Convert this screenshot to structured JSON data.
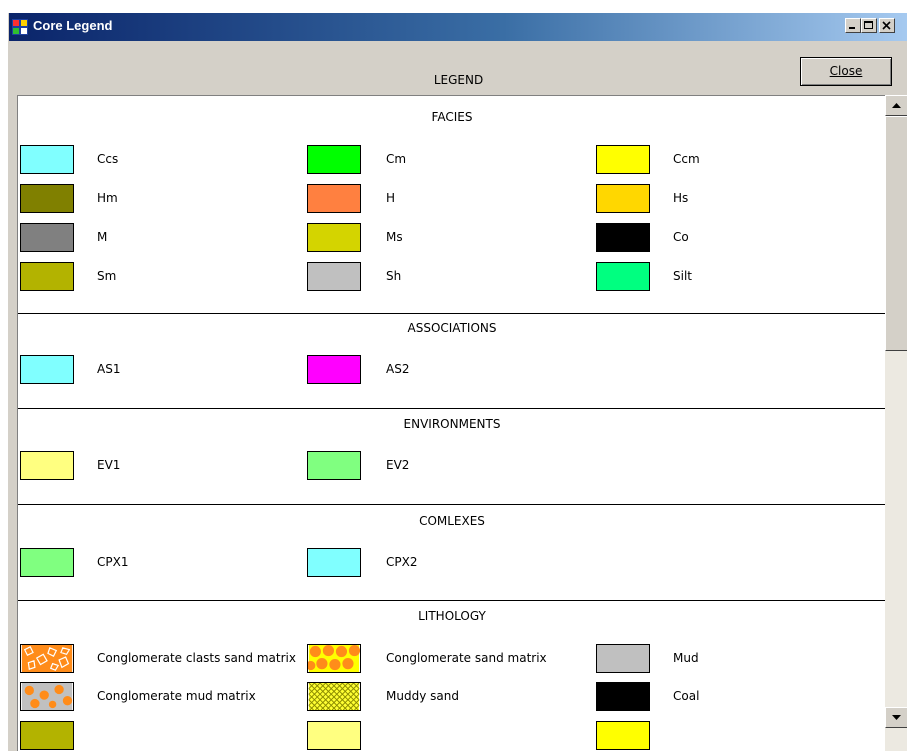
{
  "window": {
    "title": "Core Legend",
    "app_icon": "app-icon"
  },
  "header": {
    "legend_title": "LEGEND",
    "close_label": "Close"
  },
  "sections": {
    "facies": {
      "title": "FACIES",
      "items": [
        {
          "label": "Ccs",
          "color": "#80ffff"
        },
        {
          "label": "Cm",
          "color": "#00ff00"
        },
        {
          "label": "Ccm",
          "color": "#ffff00"
        },
        {
          "label": "Hm",
          "color": "#808000"
        },
        {
          "label": "H",
          "color": "#ff8040"
        },
        {
          "label": "Hs",
          "color": "#ffd700"
        },
        {
          "label": "M",
          "color": "#808080"
        },
        {
          "label": "Ms",
          "color": "#d4d400"
        },
        {
          "label": "Co",
          "color": "#000000"
        },
        {
          "label": "Sm",
          "color": "#b3b300"
        },
        {
          "label": "Sh",
          "color": "#c0c0c0"
        },
        {
          "label": "Silt",
          "color": "#00ff80"
        }
      ]
    },
    "associations": {
      "title": "ASSOCIATIONS",
      "items": [
        {
          "label": "AS1",
          "color": "#80ffff"
        },
        {
          "label": "AS2",
          "color": "#ff00ff"
        }
      ]
    },
    "environments": {
      "title": "ENVIRONMENTS",
      "items": [
        {
          "label": "EV1",
          "color": "#ffff80"
        },
        {
          "label": "EV2",
          "color": "#80ff80"
        }
      ]
    },
    "complexes": {
      "title": "COMLEXES",
      "items": [
        {
          "label": "CPX1",
          "color": "#80ff80"
        },
        {
          "label": "CPX2",
          "color": "#80ffff"
        }
      ]
    },
    "lithology": {
      "title": "LITHOLOGY",
      "items": [
        {
          "label": "Conglomerate clasts sand matrix",
          "pattern": "orange-clasts"
        },
        {
          "label": "Conglomerate sand matrix",
          "pattern": "orange-dots"
        },
        {
          "label": "Mud",
          "color": "#c0c0c0"
        },
        {
          "label": "Conglomerate mud matrix",
          "pattern": "orange-dots-gray"
        },
        {
          "label": "Muddy sand",
          "pattern": "yellow-crosshatch"
        },
        {
          "label": "Coal",
          "color": "#000000"
        }
      ]
    }
  }
}
